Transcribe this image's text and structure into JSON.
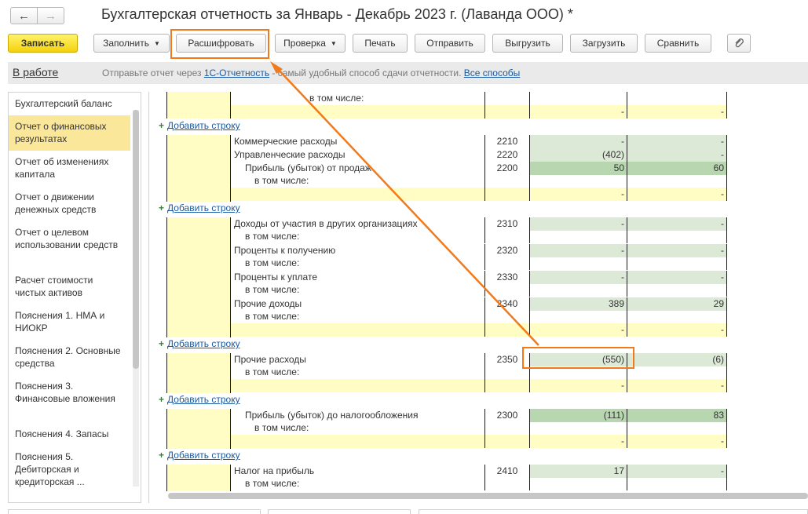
{
  "window": {
    "title": "Бухгалтерская отчетность за Январь - Декабрь 2023 г. (Лаванда ООО) *",
    "back_icon": "arrow-left-icon",
    "forward_icon": "arrow-right-icon"
  },
  "toolbar": {
    "save": "Записать",
    "fill": "Заполнить",
    "decode": "Расшифровать",
    "check": "Проверка",
    "print": "Печать",
    "send": "Отправить",
    "export": "Выгрузить",
    "import": "Загрузить",
    "compare": "Сравнить",
    "attach_icon": "paperclip-icon"
  },
  "infobar": {
    "status": "В работе",
    "text_before": "Отправьте отчет через ",
    "link1": "1С-Отчетность",
    "text_after": " - самый удобный способ сдачи отчетности. ",
    "link2": "Все способы"
  },
  "sidebar": {
    "items": [
      {
        "label": "Бухгалтерский баланс",
        "active": false
      },
      {
        "label": "Отчет о финансовых результатах",
        "active": true
      },
      {
        "label": "Отчет об изменениях капитала",
        "active": false
      },
      {
        "label": "Отчет о движении денежных средств",
        "active": false
      },
      {
        "label": "Отчет о целевом использовании средств",
        "active": false
      },
      {
        "label": "Расчет стоимости чистых активов",
        "active": false
      },
      {
        "label": "Пояснения 1. НМА и НИОКР",
        "active": false
      },
      {
        "label": "Пояснения 2. Основные средства",
        "active": false
      },
      {
        "label": "Пояснения 3. Финансовые вложения",
        "active": false
      },
      {
        "label": "Пояснения 4. Запасы",
        "active": false
      },
      {
        "label": "Пояснения 5. Дебиторская и кредиторская ...",
        "active": false
      }
    ]
  },
  "table": {
    "add_row_label": "Добавить строку",
    "in_total": "в том числе:",
    "dash": "-",
    "rows": {
      "commercial": {
        "name": "Коммерческие расходы",
        "code": "2210",
        "v1": "-",
        "v2": "-"
      },
      "admin": {
        "name": "Управленческие расходы",
        "code": "2220",
        "v1": "(402)",
        "v2": "-"
      },
      "sales_profit": {
        "name": "Прибыль (убыток) от продаж",
        "code": "2200",
        "v1": "50",
        "v2": "60"
      },
      "participation": {
        "name": "Доходы от участия в других организациях",
        "code": "2310",
        "v1": "-",
        "v2": "-"
      },
      "interest_recv": {
        "name": "Проценты к получению",
        "code": "2320",
        "v1": "-",
        "v2": "-"
      },
      "interest_pay": {
        "name": "Проценты к уплате",
        "code": "2330",
        "v1": "-",
        "v2": "-"
      },
      "other_income": {
        "name": "Прочие доходы",
        "code": "2340",
        "v1": "389",
        "v2": "29"
      },
      "other_expense": {
        "name": "Прочие расходы",
        "code": "2350",
        "v1": "(550)",
        "v2": "(6)"
      },
      "pretax_profit": {
        "name": "Прибыль (убыток) до налогообложения",
        "code": "2300",
        "v1": "(111)",
        "v2": "83"
      },
      "income_tax": {
        "name": "Налог на прибыль",
        "code": "2410",
        "v1": "17",
        "v2": "-"
      }
    }
  }
}
